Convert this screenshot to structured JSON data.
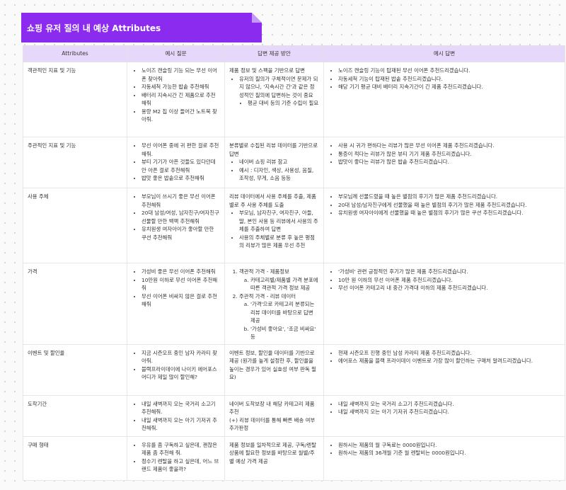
{
  "title": "쇼핑 유저 질의 내 예상 Attributes",
  "headers": [
    "Attributes",
    "예시 질문",
    "답변 제공 방안",
    "예시 답변"
  ],
  "rows": [
    {
      "attr": "객관적인 지표 및 기능",
      "questions": [
        "노이즈 캔슬링 기능 되는 무선 이어폰 찾아줘",
        "자동세척 가능한 밥솥 추천해줘",
        "배터리 지속시간 긴 제품으로 추천해줘",
        "용량 M2 칩 이상 들어간 노트북 찾아줘."
      ],
      "method_text": "제품 정보 및 스펙을 기반으로 답변",
      "method_bullets": [
        "유저의 질의가 구체적이면 문제가 되지 않으나, '지속시간 긴'과 같은 정성적인 질의에 답변하는 것이 중요"
      ],
      "method_sub": [
        "평균 대비 등의 기준 수립이 필요"
      ],
      "answers": [
        "노이즈 캔슬링 기능이 탑재된 무선 이어폰 추천드리겠습니다.",
        "자동세척 기능이 탑재된 밥솥 추천드리겠습니다.",
        "해당 기기 평균 대비 배터리 지속기간이 긴 제품 추천드리겠습니다."
      ]
    },
    {
      "attr": "주관적인 지표 및 기능",
      "questions": [
        "무선 이어폰 중에 귀 편한 걸로 추천해줘.",
        "뷰티 기기가 아픈 것들도 있다던데 안 아픈 걸로 추천해줘",
        "밥맛 좋은 밥솥으로 추천해줘"
      ],
      "method_text": "분류별로 수집된 리뷰 데이터를 기반으로 답변",
      "method_bullets": [
        "네이버 쇼핑 리뷰 참고",
        "예시 : 디자인, 색상, 사용성, 음질, 조작성, 무게, 소음 등등"
      ],
      "answers": [
        "사용 시 귀가 편하다는 리뷰가 많은 무선 이어폰 제품 추천드리겠습니다.",
        "통증이 적다는 리뷰가 많은 뷰티 기기 제품 추천드리겠습니다.",
        "밥맛이 좋다는 리뷰가 많은 밥솥 추천드리겠습니다."
      ]
    },
    {
      "attr": "사용 주체",
      "questions": [
        "부모님이 쓰시기 좋은 무선 이어폰 추천해줘",
        "20대 남성/여성, 남자친구/여자친구 선물할 만한 백팩 추천해줘",
        "유치원생 여자아이가 좋아할 만한 쿠션 추천해줘"
      ],
      "method_text": "리뷰 데이터에서 사용 주체를 추출, 제품별로 주 사용 주체를 도출",
      "method_bullets": [
        "부모님, 남자친구, 여자친구, 아들, 딸, 본인 사용 등 리뷰에서 사용의 주체를 추출하여 답변",
        "사용의 주체별로 분류 후 높은 평점의 리뷰가 많은 제품 우선 추천"
      ],
      "answers": [
        "부모님께 선물드렸을 때 높은 별점의 후기가 많은 제품 추천드리겠습니다.",
        "20대 남성/남자친구에게 선물했을 때 높은 별점의 후기가 많은 제품 추천드리겠습니다.",
        "유치원생 여자아이에게 선물했을 때 높은 별점의 후기가 많은 쿠션 추천드리겠습니다."
      ]
    },
    {
      "attr": "가격",
      "questions": [
        "가성비 좋은 무선 이어폰 추천해줘",
        "10만원 이하로 무선 이어폰 추천해줘",
        "무선 이어폰 비싸지 않은 걸로 추천해줘"
      ],
      "method_num": [
        {
          "text": "객관적 가격 - 제품정보",
          "sub": [
            "카테고리별/제품별 가격 분포에 따른 객관적 가격 정보 제공"
          ]
        },
        {
          "text": "주관적 가격 - 리뷰 데이터",
          "sub": [
            "'가격'으로 카테고리 분류되는 리뷰 데이터를 바탕으로 답변 제공",
            "'가성비 좋아요', '조금 비싸요' 등"
          ]
        }
      ],
      "answers": [
        "'가성비' 관련 긍정적인 후기가 많은 제품 추천드리겠습니다.",
        "10만 원 이하의 무선 이어폰 제품 추천드리겠습니다.",
        "무선 이어폰 카테고리 내 중간 가격대 이하의 제품 추천드리겠습니다."
      ]
    },
    {
      "attr": "이벤트 및 할인율",
      "questions": [
        "지금 시즌오프 중인 남자 카라티 찾아줘.",
        "블랙프라이데이에 나이키 에어포스 어디가 제일 많이 할인해?"
      ],
      "method_text": "이벤트 정보, 할인율 데이터를 기반으로 제공 (원가를 높게 설정한 후, 할인율을 높이는 경우가 있어 실효성 여부 판독 필요)",
      "answers": [
        "현재 시즌오프 진행 중인 남성 카라티 제품 추천드리겠습니다.",
        "에어포스 제품을 블랙 프라이데이 이벤트로 가장 많이 할인하는 구매처 알려드리겠습니다."
      ]
    },
    {
      "attr": "도착기간",
      "questions": [
        "내일 새벽까지 오는 국거리 소고기 추천해줘.",
        "내일 새벽까지 오는 아기 기저귀 추천해줘."
      ],
      "method_text": "네이버 도착보장 내 해당 카테고리 제품 추천",
      "method_text2": "(+) 리뷰 데이터를 통해 빠른 배송 여부 추가판정",
      "answers": [
        "내일 새벽까지 오는 국거리 소고기 추천드리겠습니다.",
        "내일 새벽까지 오는 아기 기저귀 추천드리겠습니다."
      ]
    },
    {
      "attr": "구매 형태",
      "questions": [
        "우유를 좀 구독하고 싶은데, 괜찮은 제품 좀 추천해 줘.",
        "정수기 렌탈을 하고 싶은데, 어느 브랜드 제품이 좋을까?"
      ],
      "method_text": "제품 정보를 일차적으로 제공, 구독/렌탈 상품에 필요한 정보를 바탕으로 월별/주별 예상 가격 제공",
      "answers": [
        "원하시는 제품의 월 구독료는 0000원입니다.",
        "원하시는 제품의 36개월 기준 월 렌탈비는 0000원입니다."
      ]
    }
  ]
}
